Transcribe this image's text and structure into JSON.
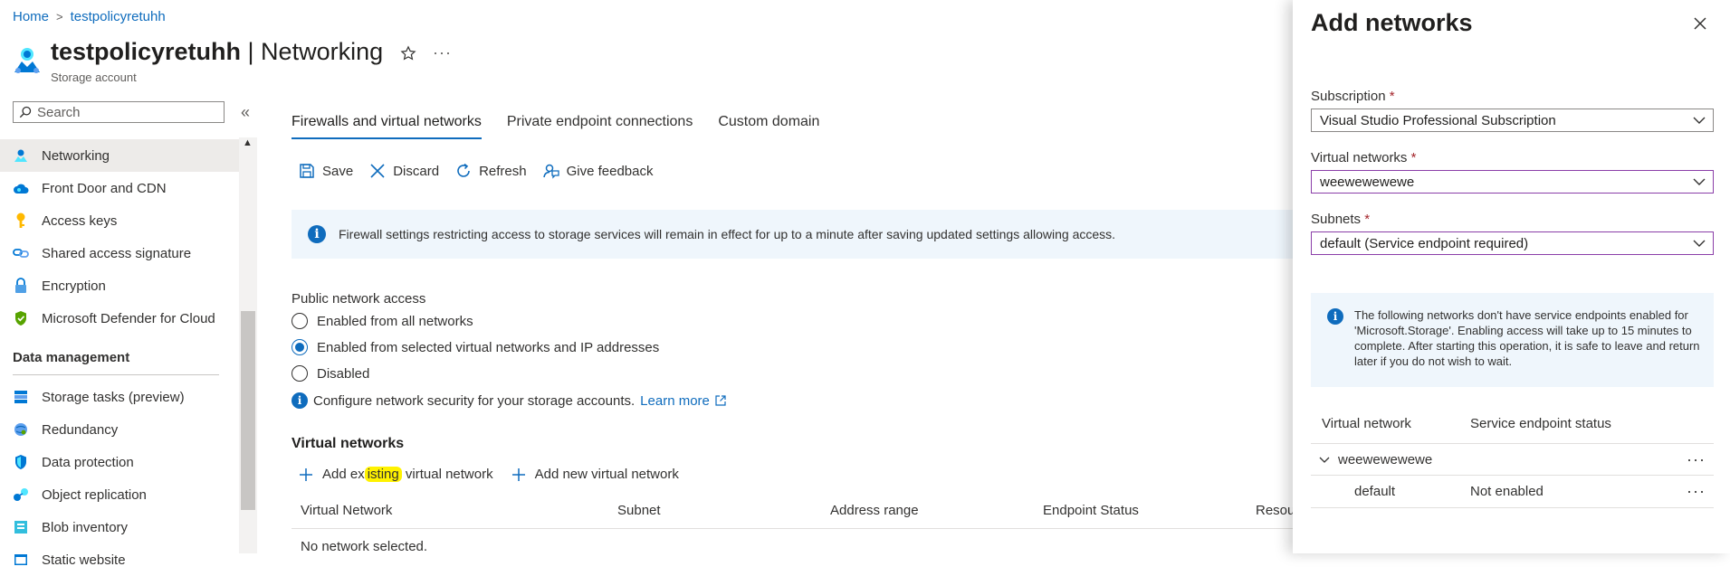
{
  "breadcrumb": {
    "home": "Home",
    "resource": "testpolicyretuhh"
  },
  "header": {
    "resource_name": "testpolicyretuhh",
    "section": "| Networking",
    "subtitle": "Storage account",
    "more": "···"
  },
  "sidebar": {
    "search_placeholder": "Search",
    "collapse": "«",
    "items": [
      {
        "label": "Networking",
        "icon": "networking-icon",
        "active": true
      },
      {
        "label": "Front Door and CDN",
        "icon": "cloud-icon"
      },
      {
        "label": "Access keys",
        "icon": "key-icon"
      },
      {
        "label": "Shared access signature",
        "icon": "link-icon"
      },
      {
        "label": "Encryption",
        "icon": "lock-icon"
      },
      {
        "label": "Microsoft Defender for Cloud",
        "icon": "shield-icon"
      }
    ],
    "section_data_management": "Data management",
    "data_items": [
      {
        "label": "Storage tasks (preview)",
        "icon": "tasks-icon"
      },
      {
        "label": "Redundancy",
        "icon": "globe-icon"
      },
      {
        "label": "Data protection",
        "icon": "shield-icon"
      },
      {
        "label": "Object replication",
        "icon": "replication-icon"
      },
      {
        "label": "Blob inventory",
        "icon": "inventory-icon"
      },
      {
        "label": "Static website",
        "icon": "website-icon"
      }
    ]
  },
  "tabs": [
    "Firewalls and virtual networks",
    "Private endpoint connections",
    "Custom domain"
  ],
  "toolbar": {
    "save": "Save",
    "discard": "Discard",
    "refresh": "Refresh",
    "feedback": "Give feedback"
  },
  "banner": "Firewall settings restricting access to storage services will remain in effect for up to a minute after saving updated settings allowing access.",
  "public_access": {
    "label": "Public network access",
    "options": [
      "Enabled from all networks",
      "Enabled from selected virtual networks and IP addresses",
      "Disabled"
    ],
    "selected": 1
  },
  "config": {
    "text": "Configure network security for your storage accounts.",
    "link": "Learn more"
  },
  "virtual_networks": {
    "heading": "Virtual networks",
    "add_existing_prefix": "Add ex",
    "add_existing_highlight": "isting",
    "add_existing_suffix": " virtual network",
    "add_new": "Add new virtual network",
    "columns": [
      "Virtual Network",
      "Subnet",
      "Address range",
      "Endpoint Status",
      "Resourc"
    ],
    "empty": "No network selected."
  },
  "panel": {
    "title": "Add networks",
    "subscription_label": "Subscription",
    "subscription_value": "Visual Studio Professional Subscription",
    "vnet_label": "Virtual networks",
    "vnet_value": "weewewewewe",
    "subnets_label": "Subnets",
    "subnets_value": "default (Service endpoint required)",
    "required_mark": "*",
    "info": "The following networks don't have service endpoints enabled for 'Microsoft.Storage'. Enabling access will take up to 15 minutes to complete. After starting this operation, it is safe to leave and return later if you do not wish to wait.",
    "table_cols": [
      "Virtual network",
      "Service endpoint status"
    ],
    "rows": [
      {
        "name": "weewewewewe",
        "status": ""
      },
      {
        "name": "default",
        "status": "Not enabled"
      }
    ],
    "row_more": "···"
  },
  "colors": {
    "accent": "#0f6cbd",
    "focus_border": "#8a3ea8",
    "info_bg": "#eff6fc",
    "highlight": "#fff200"
  }
}
